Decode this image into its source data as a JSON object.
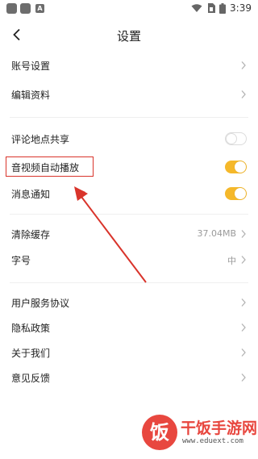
{
  "status_bar": {
    "time": "3:39",
    "icons": [
      "app-icon",
      "app-icon",
      "a-icon",
      "wifi-icon",
      "sim-icon",
      "battery-icon"
    ]
  },
  "header": {
    "title": "设置",
    "back_icon": "back-arrow-icon"
  },
  "settings": {
    "account": "账号设置",
    "edit_profile": "编辑资料",
    "comment_location": "评论地点共享",
    "video_autoplay": "音视频自动播放",
    "notifications": "消息通知",
    "clear_cache": "清除缓存",
    "cache_size": "37.04MB",
    "font_size": "字号",
    "font_size_value": "中",
    "user_agreement": "用户服务协议",
    "privacy_policy": "隐私政策",
    "about_us": "关于我们",
    "feedback": "意见反馈"
  },
  "toggles": {
    "comment_location": false,
    "video_autoplay": true,
    "notifications": true
  },
  "colors": {
    "toggle_on": "#f5b82a",
    "annotation_red": "#d9342b",
    "watermark_red": "#e8473f"
  },
  "watermark": {
    "badge": "饭",
    "title": "干饭手游网",
    "url": "www.eduext.com"
  }
}
